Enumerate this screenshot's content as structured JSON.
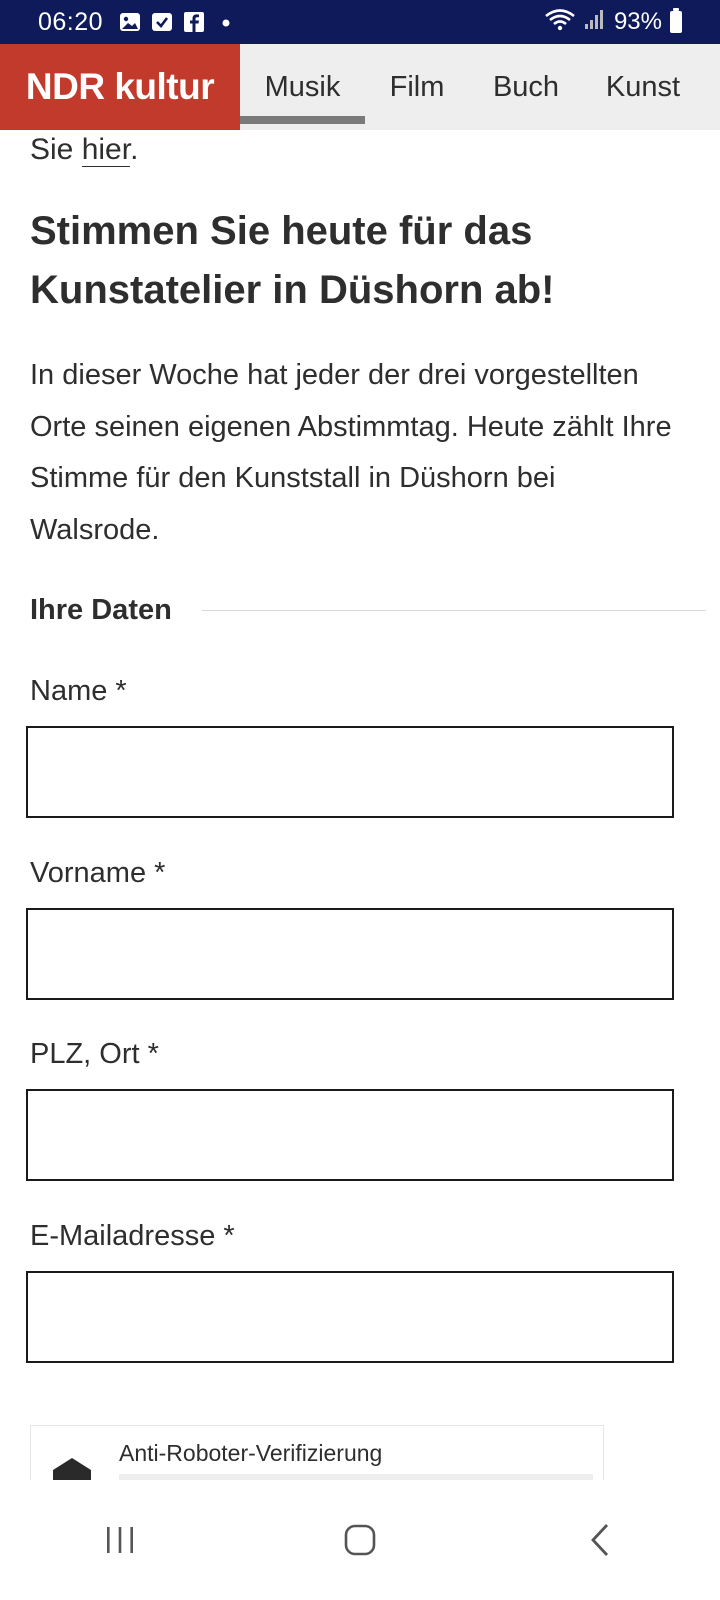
{
  "status_bar": {
    "time": "06:20",
    "battery": "93%",
    "icons": [
      "gallery-icon",
      "check-icon",
      "facebook-icon",
      "dot-icon",
      "wifi-icon",
      "signal-icon",
      "battery-icon"
    ]
  },
  "header": {
    "logo_text": "NDR kultur",
    "tabs": [
      {
        "label": "Musik",
        "active": true
      },
      {
        "label": "Film",
        "active": false
      },
      {
        "label": "Buch",
        "active": false
      },
      {
        "label": "Kunst",
        "active": false
      }
    ],
    "brand_color": "#c23a2b"
  },
  "article": {
    "intro_prefix": "Sie ",
    "intro_link": "hier",
    "intro_suffix": ".",
    "headline": "Stimmen Sie heute für das Kunstatelier in Düshorn ab!",
    "body": "In dieser Woche hat jeder der drei vorgestellten Orte seinen eigenen Abstimmtag. Heute zählt Ihre Stimme für den Kunststall in Düshorn bei Walsrode."
  },
  "form": {
    "section_title": "Ihre Daten",
    "fields": [
      {
        "label": "Name *",
        "value": ""
      },
      {
        "label": "Vorname *",
        "value": ""
      },
      {
        "label": "PLZ, Ort *",
        "value": ""
      },
      {
        "label": "E-Mailadresse *",
        "value": ""
      }
    ],
    "captcha_label": "Anti-Roboter-Verifizierung"
  },
  "system_nav": {
    "buttons": [
      "recents-icon",
      "home-icon",
      "back-icon"
    ]
  }
}
